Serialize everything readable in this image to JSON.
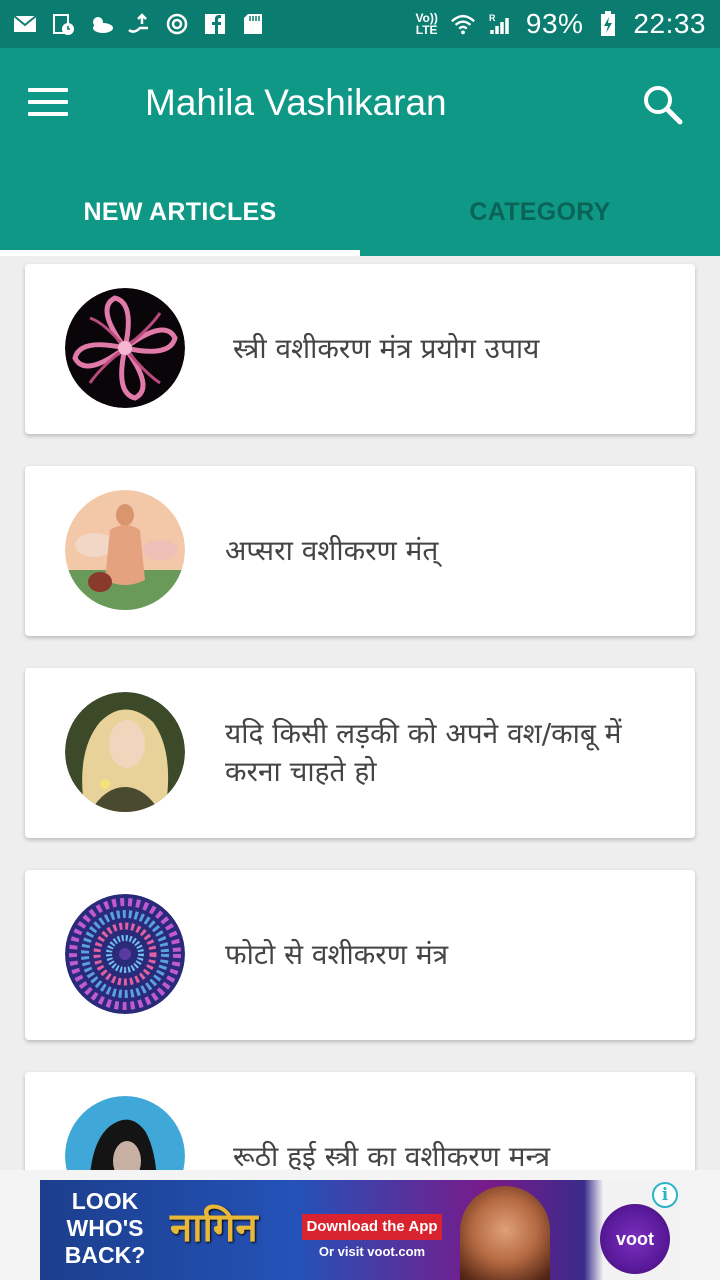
{
  "status_bar": {
    "left_icons": [
      "mail-icon",
      "calendar-icon",
      "weather-icon",
      "transfer-icon",
      "sync-icon",
      "facebook-icon",
      "sd-card-icon"
    ],
    "network_line1": "Vo))",
    "network_line2": "LTE",
    "battery": "93%",
    "time": "22:33"
  },
  "toolbar": {
    "title": "Mahila Vashikaran"
  },
  "tabs": [
    {
      "label": "NEW ARTICLES"
    },
    {
      "label": "CATEGORY"
    }
  ],
  "articles": [
    {
      "title": "स्त्री वशीकरण मंत्र प्रयोग उपाय"
    },
    {
      "title": "अप्सरा वशीकरण मंत्"
    },
    {
      "title": "यदि किसी लड़की को अपने वश/काबू में करना चाहते हो"
    },
    {
      "title": "फोटो से वशीकरण मंत्र"
    },
    {
      "title": "रूठी हुई स्त्री का वशीकरण मन्त्र"
    }
  ],
  "ad": {
    "headline": "LOOK WHO'S BACK?",
    "logo_text": "नागिन",
    "button_label": "Download the App",
    "visit_text": "Or visit voot.com",
    "brand": "voot",
    "info_label": "i"
  },
  "colors": {
    "status_bar": "#0a7d70",
    "toolbar": "#0f9886",
    "background": "#eeeeee"
  }
}
